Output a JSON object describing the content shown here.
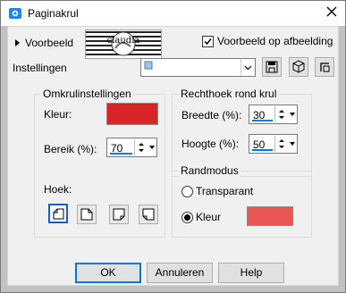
{
  "window": {
    "title": "Paginakrul",
    "icon": "app-icon",
    "close_icon": "close-icon"
  },
  "preview": {
    "label": "Voorbeeld",
    "thumbnail_text": "claudia",
    "toggle_label": "Voorbeeld op afbeelding",
    "toggle_checked": true
  },
  "settings": {
    "label": "Instellingen",
    "value": "",
    "buttons": [
      "save-preset-icon",
      "random-icon",
      "reset-icon"
    ]
  },
  "curl_settings": {
    "title": "Omkrulinstellingen",
    "color_label": "Kleur:",
    "color": "#d9252a",
    "range_label": "Bereik (%):",
    "range_value": "70",
    "corner_label": "Hoek:",
    "corners": [
      "top-left",
      "top-right",
      "bottom-right",
      "bottom-left"
    ],
    "selected_corner": "top-left"
  },
  "rect": {
    "title": "Rechthoek rond krul",
    "width_label": "Breedte (%):",
    "width_value": "30",
    "height_label": "Hoogte (%):",
    "height_value": "50"
  },
  "edge": {
    "title": "Randmodus",
    "transparent_label": "Transparant",
    "color_label": "Kleur",
    "selected": "Kleur",
    "color": "#eb5553"
  },
  "buttons": {
    "ok": "OK",
    "cancel": "Annuleren",
    "help": "Help"
  }
}
